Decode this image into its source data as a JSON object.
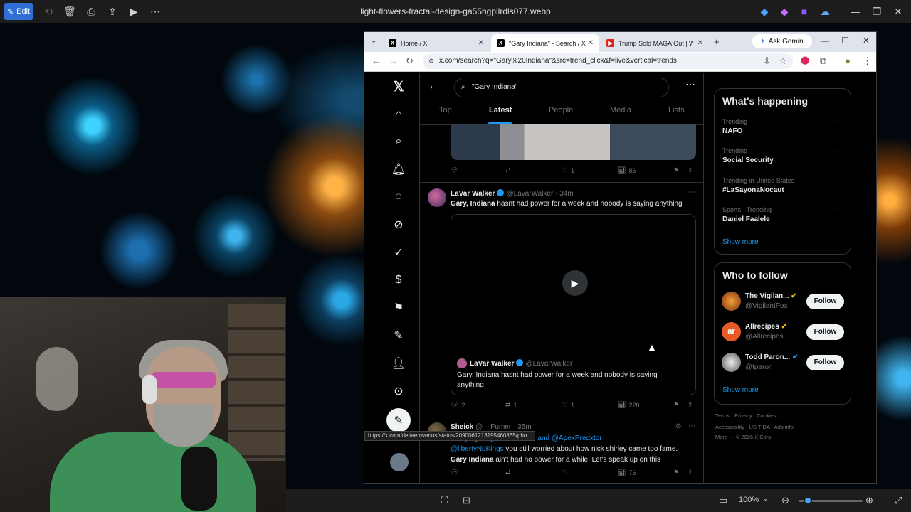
{
  "viewer": {
    "edit_label": "Edit",
    "title": "light-flowers-fractal-design-ga55hgpllrdls077.webp",
    "zoom": "100%"
  },
  "browser": {
    "tabs": [
      {
        "label": "Home / X"
      },
      {
        "label": "\"Gary Indiana\" - Search / X"
      },
      {
        "label": "Trump Sold MAGA Out | With"
      }
    ],
    "ask_gemini": "Ask Gemini",
    "url": "x.com/search?q=\"Gary%20Indiana\"&src=trend_click&f=live&vertical=trends",
    "status_url": "https://x.com/deltaemvenus/status/2090061213195460865/pho..."
  },
  "search": {
    "query": "\"Gary Indiana\"",
    "tabs": [
      "Top",
      "Latest",
      "People",
      "Media",
      "Lists"
    ]
  },
  "prev_post": {
    "reply": "",
    "repost": "",
    "like": "1",
    "views": "86"
  },
  "post1": {
    "name": "LaVar Walker",
    "handle": "@LavarWalker",
    "time": "· 34m",
    "text_bold": "Gary, Indiana",
    "text_rest": " hasnt had power for a week and nobody is saying anything",
    "quote_name": "LaVar Walker",
    "quote_handle": "@LavarWalker",
    "quote_text": "Gary, Indiana hasnt had power for a week and nobody is saying anything",
    "reply": "2",
    "repost": "1",
    "like": "1",
    "views": "220"
  },
  "post2": {
    "name": "Sheick",
    "handle": "@__Fumer",
    "time": "· 35m",
    "replying_prefix": "Replying to ",
    "replying_to": "@CarrieCnh12 and @ApexPredxtor",
    "mention": "@libertyNoKings",
    "line1_rest": " you still worried about how nick shirley came too fame.",
    "line2_bold": "Gary Indiana",
    "line2_rest": " ain't had no power for a while. Let's speak up on this",
    "views": "76"
  },
  "trends": {
    "title": "What's happening",
    "items": [
      {
        "meta": "Trending",
        "name": "NAFO"
      },
      {
        "meta": "Trending",
        "name": "Social Security"
      },
      {
        "meta": "Trending in United States",
        "name": "#LaSayonaNocaut"
      },
      {
        "meta": "Sports · Trending",
        "name": "Daniel Faalele"
      }
    ],
    "show_more": "Show more"
  },
  "who_to_follow": {
    "title": "Who to follow",
    "items": [
      {
        "name": "The Vigilan...",
        "handle": "@VigilantFox",
        "button": "Follow"
      },
      {
        "name": "Allrecipes",
        "handle": "@Allrecipes",
        "button": "Follow"
      },
      {
        "name": "Todd Paron...",
        "handle": "@tparon",
        "button": "Follow"
      }
    ],
    "show_more": "Show more"
  },
  "footer": {
    "line1": "Terms · Privacy · Cookies ·",
    "line2": "Accessibility · US TIDA · Ads info ·",
    "line3": "More ··· © 2026 X Corp."
  }
}
